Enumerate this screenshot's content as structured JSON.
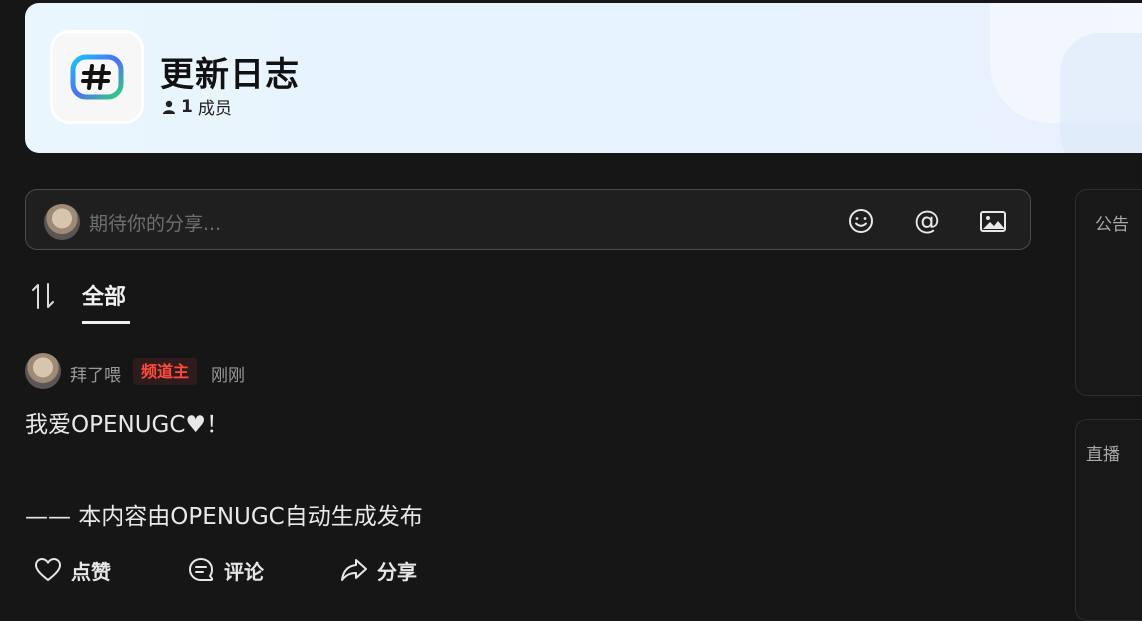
{
  "channel": {
    "title": "更新日志",
    "member_count": "1",
    "member_label": "成员",
    "logo_icon": "hash-icon"
  },
  "composer": {
    "placeholder": "期待你的分享...",
    "tools": [
      "emoji-icon",
      "at-icon",
      "image-icon"
    ],
    "at_symbol": "@"
  },
  "tabs": {
    "sort_icon": "sort-icon",
    "active": "全部"
  },
  "post": {
    "author": "拜了喂",
    "badge": "频道主",
    "time": "刚刚",
    "body": "我爱OPENUGC♥！",
    "footer": "—— 本内容由OPENUGC自动生成发布",
    "actions": {
      "like": "点赞",
      "comment": "评论",
      "share": "分享"
    }
  },
  "sidebar": {
    "notice_title": "公告",
    "live_title": "直播"
  },
  "colors": {
    "background": "#161616",
    "banner": "#e7f4fd",
    "badge_text": "#ff4a3d",
    "badge_bg": "#2e1c1c"
  }
}
